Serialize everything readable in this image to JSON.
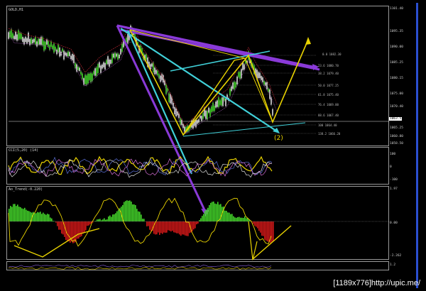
{
  "chart_panel": {
    "symbol_label": "GOLD,H1",
    "current_price_tag": "1063.5",
    "wave_label": "(2)",
    "price_axis": [
      "1101.40",
      "1095.35",
      "1090.00",
      "1085.25",
      "1080.15",
      "1075.00",
      "1070.40",
      "1065.25",
      "1060.80",
      "1058.50"
    ],
    "fib_levels": [
      "0.0  1082.30",
      "23.6  1080.70",
      "38.2  1079.40",
      "50.0  1077.25",
      "61.8  1075.40",
      "76.4  1069.00",
      "88.6  1067.40",
      "100  1064.40",
      "138.2  1066.20",
      "161.8  1068.90"
    ]
  },
  "oscillator1": {
    "label": "CCI(5,20) (14)",
    "axis": [
      "100",
      "0",
      "-100"
    ]
  },
  "oscillator2": {
    "label": "Ao_Trend(-0.220)",
    "axis": [
      "1.97",
      "0.00",
      "-2.262"
    ]
  },
  "bottom_panel": {
    "axis": [
      "1.2"
    ]
  },
  "footer": {
    "size_text": "[1189x776]",
    "url_text": "http://upic.me/"
  },
  "colors": {
    "background": "#000000",
    "yellow": "#e8d200",
    "cyan": "#40d0d8",
    "purple": "#8a3ad8",
    "green": "#44d52a",
    "red": "#d01818",
    "sidebar": "#2b4fd0"
  }
}
